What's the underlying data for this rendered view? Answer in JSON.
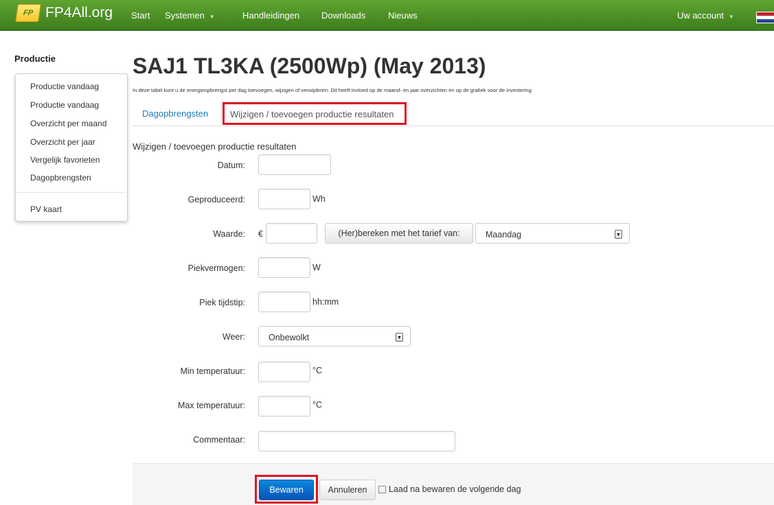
{
  "brand": {
    "logo_text": "FP",
    "name": "FP4All.org"
  },
  "nav": {
    "items": [
      {
        "label": "Start",
        "caret": false
      },
      {
        "label": "Systemen",
        "caret": true
      },
      {
        "label": "Handleidingen",
        "caret": false
      },
      {
        "label": "Downloads",
        "caret": false
      },
      {
        "label": "Nieuws",
        "caret": false
      }
    ],
    "account": {
      "label": "Uw account",
      "caret": true
    }
  },
  "sidebar": {
    "title": "Productie",
    "items": [
      {
        "label": "Productie vandaag"
      },
      {
        "label": "Productie vandaag"
      },
      {
        "label": "Overzicht per maand"
      },
      {
        "label": "Overzicht per jaar"
      },
      {
        "label": "Vergelijk favorieten"
      },
      {
        "label": "Dagopbrengsten"
      },
      {
        "label": "PV kaart"
      }
    ]
  },
  "main": {
    "title": "SAJ1 TL3KA (2500Wp) (May 2013)",
    "description": "In deze tabel kunt u de energieopbrengst per dag toevoegen, wijzigen of verwijderen. Dit heeft invloed op de maand- en jaar overzichten en op de grafiek voor de investering.",
    "tabs": [
      {
        "label": "Dagopbrengsten",
        "active": false
      },
      {
        "label": "Wijzigen / toevoegen productie resultaten",
        "active": true
      }
    ]
  },
  "form": {
    "heading": "Wijzigen / toevoegen productie resultaten",
    "datum": {
      "label": "Datum:",
      "value": ""
    },
    "geproduceerd": {
      "label": "Geproduceerd:",
      "value": "",
      "unit": "Wh"
    },
    "waarde": {
      "label": "Waarde:",
      "currency": "€",
      "value": "",
      "recalc_button": "(Her)bereken met het tarief van:",
      "tarief_selected": "Maandag"
    },
    "piekvermogen": {
      "label": "Piekvermogen:",
      "value": "",
      "unit": "W"
    },
    "piek_tijdstip": {
      "label": "Piek tijdstip:",
      "value": "",
      "unit": "hh:mm"
    },
    "weer": {
      "label": "Weer:",
      "selected": "Onbewolkt"
    },
    "min_temp": {
      "label": "Min temperatuur:",
      "value": "",
      "unit": "°C"
    },
    "max_temp": {
      "label": "Max temperatuur:",
      "value": "",
      "unit": "°C"
    },
    "commentaar": {
      "label": "Commentaar:",
      "value": ""
    }
  },
  "actions": {
    "save": "Bewaren",
    "cancel": "Annuleren",
    "next_day_checkbox": {
      "label": "Laad na bewaren de volgende dag",
      "checked": false
    }
  },
  "colors": {
    "navbar": "#4c8f26",
    "link": "#1b7cbb",
    "primary_button": "#0a6fcf",
    "highlight_box": "#e0121e"
  }
}
